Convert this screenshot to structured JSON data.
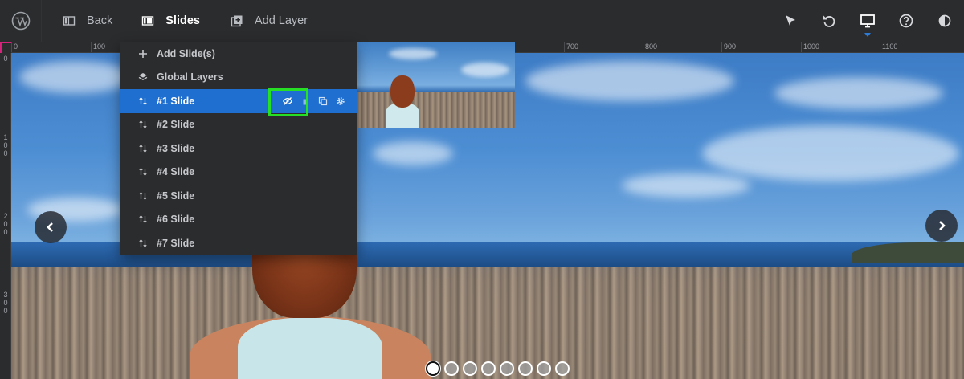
{
  "toolbar": {
    "back_label": "Back",
    "slides_label": "Slides",
    "add_layer_label": "Add Layer",
    "right_icons": [
      "cursor-icon",
      "undo-icon",
      "desktop-icon",
      "help-icon",
      "contrast-icon"
    ]
  },
  "ruler": {
    "top_ticks": [
      "0",
      "100",
      "700",
      "800",
      "900",
      "1000",
      "1100"
    ],
    "left_ticks": [
      "0",
      "100",
      "200",
      "300"
    ]
  },
  "slides_menu": {
    "add_slide_label": "Add Slide(s)",
    "global_layers_label": "Global Layers",
    "slides": [
      "#1 Slide",
      "#2 Slide",
      "#3 Slide",
      "#4 Slide",
      "#5 Slide",
      "#6 Slide",
      "#7 Slide"
    ],
    "active_slide_index": 0,
    "active_slide_actions": [
      "eye-hidden-icon",
      "trash-icon",
      "duplicate-icon",
      "gear-icon"
    ]
  },
  "carousel": {
    "bullet_count": 8,
    "active_bullet": 0
  },
  "colors": {
    "accent": "#1e6fd0",
    "highlight": "#27e026",
    "toolbar_bg": "#2b2c2e"
  }
}
